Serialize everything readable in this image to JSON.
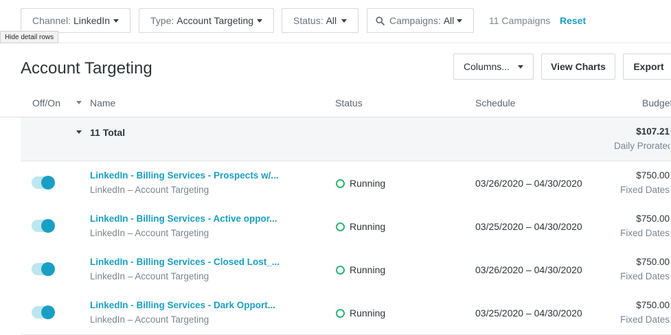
{
  "filters": {
    "channel": {
      "label": "Channel:",
      "value": "LinkedIn"
    },
    "type": {
      "label": "Type:",
      "value": "Account Targeting"
    },
    "status": {
      "label": "Status:",
      "value": "All"
    },
    "campaigns": {
      "label": "Campaigns:",
      "value": "All"
    },
    "count": "11 Campaigns",
    "reset": "Reset"
  },
  "tooltip": "Hide detail rows",
  "page_title": "Account Targeting",
  "toolbar": {
    "columns": "Columns...",
    "view_charts": "View Charts",
    "export": "Export"
  },
  "table": {
    "headers": {
      "offon": "Off/On",
      "name": "Name",
      "status": "Status",
      "schedule": "Schedule",
      "budget": "Budget"
    },
    "total": {
      "label": "11 Total",
      "budget": "$107.21",
      "budget_type": "Daily Prorated"
    },
    "rows": [
      {
        "name": "LinkedIn - Billing Services - Prospects w/...",
        "sub": "LinkedIn – Account Targeting",
        "status": "Running",
        "schedule": "03/26/2020 – 04/30/2020",
        "budget": "$750.00",
        "budget_type": "Fixed Dates"
      },
      {
        "name": "LinkedIn - Billing Services - Active oppor...",
        "sub": "LinkedIn – Account Targeting",
        "status": "Running",
        "schedule": "03/25/2020 – 04/30/2020",
        "budget": "$750.00",
        "budget_type": "Fixed Dates"
      },
      {
        "name": "LinkedIn - Billing Services - Closed Lost_...",
        "sub": "LinkedIn – Account Targeting",
        "status": "Running",
        "schedule": "03/26/2020 – 04/30/2020",
        "budget": "$750.00",
        "budget_type": "Fixed Dates"
      },
      {
        "name": "LinkedIn - Billing Services - Dark Opport...",
        "sub": "LinkedIn – Account Targeting",
        "status": "Running",
        "schedule": "03/25/2020 – 04/30/2020",
        "budget": "$750.00",
        "budget_type": "Fixed Dates"
      }
    ]
  },
  "colors": {
    "accent": "#1a9fc4",
    "running": "#2bb673"
  }
}
